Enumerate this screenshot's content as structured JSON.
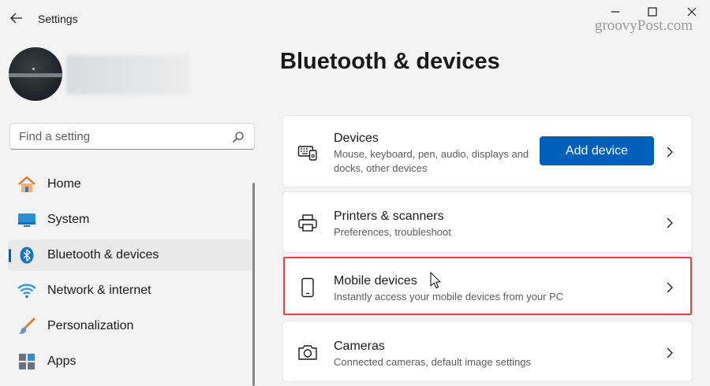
{
  "window": {
    "title": "Settings",
    "watermark": "groovyPost.com"
  },
  "search": {
    "placeholder": "Find a setting"
  },
  "sidebar": {
    "items": [
      {
        "label": "Home",
        "icon": "home-icon",
        "active": false
      },
      {
        "label": "System",
        "icon": "system-icon",
        "active": false
      },
      {
        "label": "Bluetooth & devices",
        "icon": "bluetooth-icon",
        "active": true
      },
      {
        "label": "Network & internet",
        "icon": "wifi-icon",
        "active": false
      },
      {
        "label": "Personalization",
        "icon": "brush-icon",
        "active": false
      },
      {
        "label": "Apps",
        "icon": "apps-icon",
        "active": false
      }
    ]
  },
  "main": {
    "title": "Bluetooth & devices",
    "cards": [
      {
        "title": "Devices",
        "subtitle": "Mouse, keyboard, pen, audio, displays and docks, other devices",
        "icon": "devices-icon",
        "button": "Add device"
      },
      {
        "title": "Printers & scanners",
        "subtitle": "Preferences, troubleshoot",
        "icon": "printer-icon"
      },
      {
        "title": "Mobile devices",
        "subtitle": "Instantly access your mobile devices from your PC",
        "icon": "phone-icon",
        "highlighted": true
      },
      {
        "title": "Cameras",
        "subtitle": "Connected cameras, default image settings",
        "icon": "camera-icon"
      }
    ]
  },
  "colors": {
    "accent": "#005fb8",
    "highlight": "#e8413e",
    "background": "#f3f3f3"
  }
}
